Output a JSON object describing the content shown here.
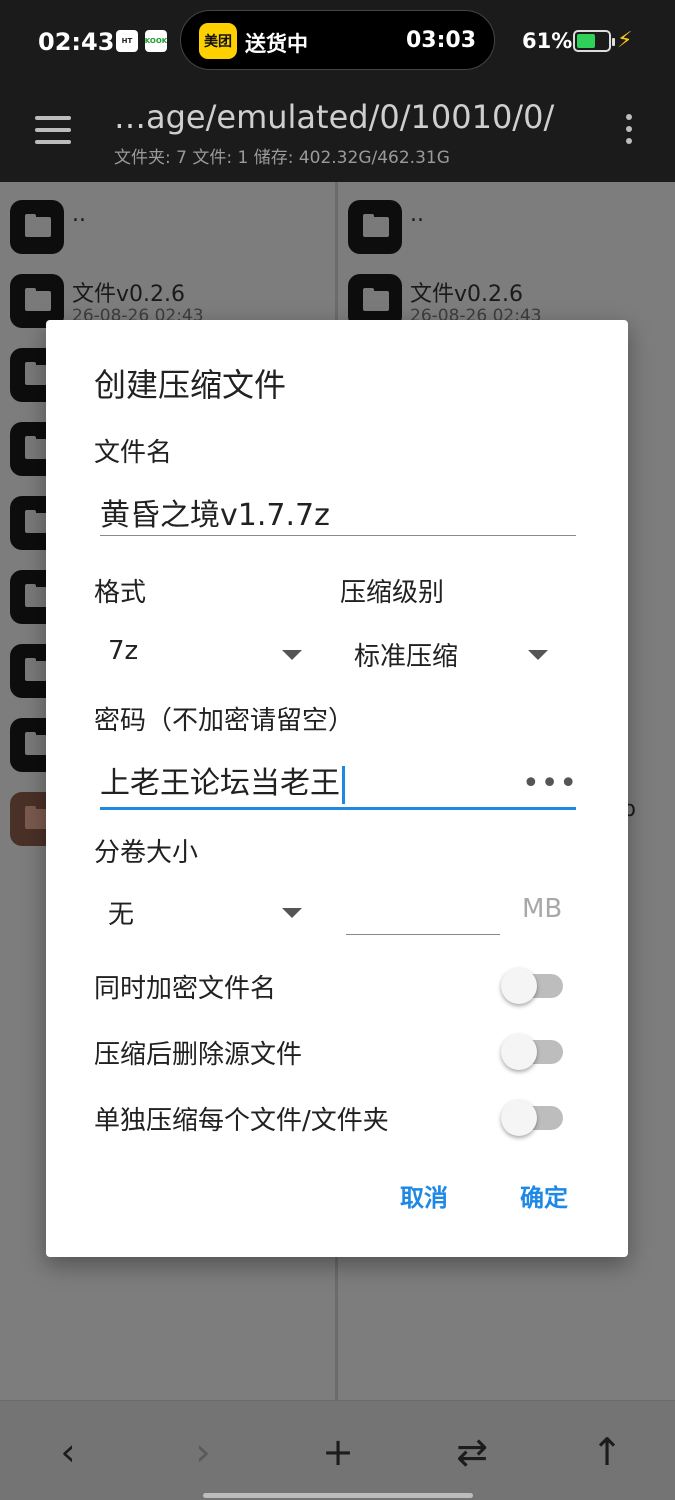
{
  "status_bar": {
    "time": "02:43",
    "icon1": "HT",
    "icon2": "KOOK",
    "island_app": "美团",
    "island_text": "送货中",
    "island_time": "03:03",
    "battery_percent": "61%",
    "battery_level": 0.61,
    "battery_color": "#30d158"
  },
  "app_bar": {
    "path": "…age/emulated/0/10010/0/",
    "info": "文件夹: 7  文件: 1  储存: 402.32G/462.31G"
  },
  "left_pane": {
    "parent": "..",
    "item_name": "文件v0.2.6",
    "item_date": "26-08-26 02:43"
  },
  "right_pane": {
    "parent": "..",
    "item_name": "文件v0.2.6",
    "item_date": "26-08-26 02:43",
    "peek_char": "b"
  },
  "dialog": {
    "title": "创建压缩文件",
    "filename_label": "文件名",
    "filename_value": "黄昏之境v1.7.7z",
    "format_label": "格式",
    "format_value": "7z",
    "level_label": "压缩级别",
    "level_value": "标准压缩",
    "password_label": "密码（不加密请留空）",
    "password_value": "上老王论坛当老王",
    "password_toggle": "•••",
    "volume_label": "分卷大小",
    "volume_value": "无",
    "volume_size_value": "",
    "volume_unit": "MB",
    "encrypt_names_label": "同时加密文件名",
    "encrypt_names_on": false,
    "delete_source_label": "压缩后删除源文件",
    "delete_source_on": false,
    "separate_label": "单独压缩每个文件/文件夹",
    "separate_on": false,
    "cancel": "取消",
    "ok": "确定",
    "accent_color": "#1e88e5"
  },
  "bottom_bar": {
    "back": "‹",
    "forward": "›",
    "add": "+",
    "swap": "⇄",
    "up": "↑"
  }
}
